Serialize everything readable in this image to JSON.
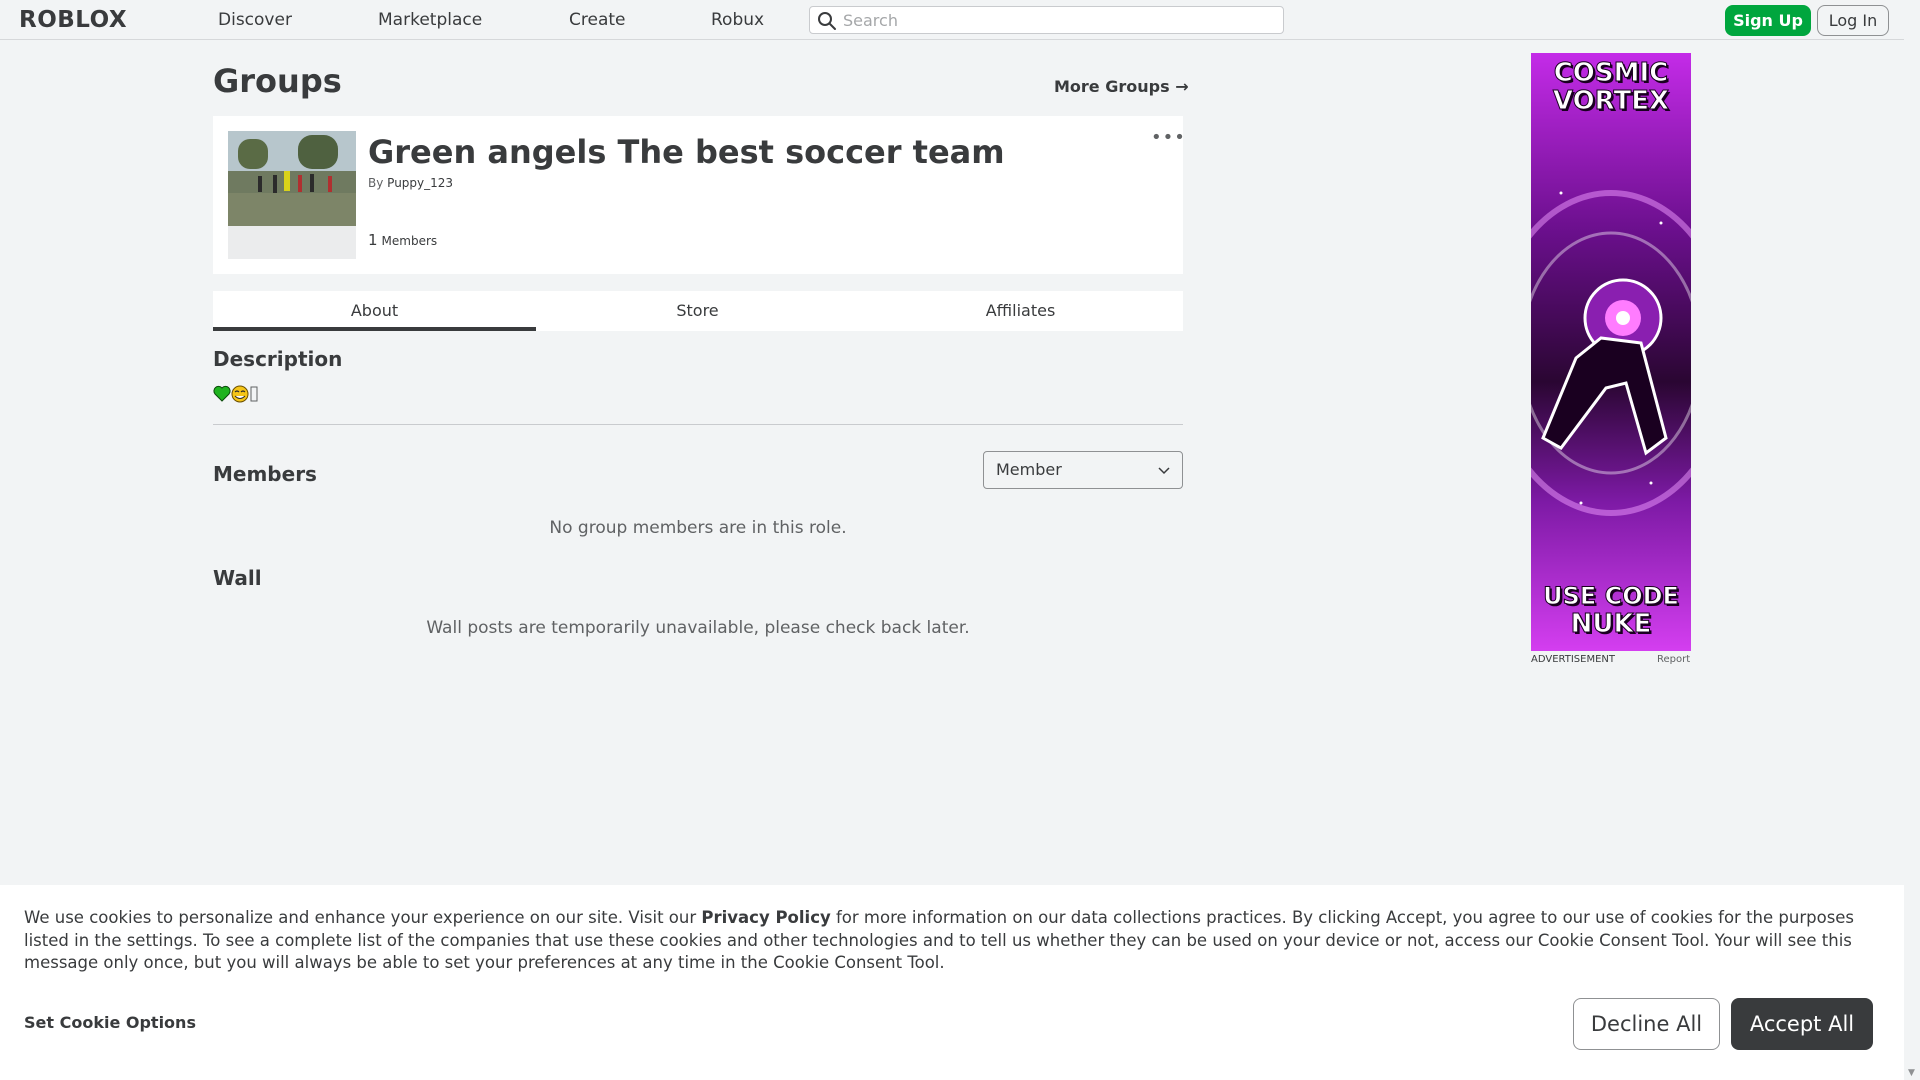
{
  "nav": {
    "logo_text": "ROBLOX",
    "links": [
      "Discover",
      "Marketplace",
      "Create",
      "Robux"
    ],
    "search_placeholder": "Search",
    "signup_label": "Sign Up",
    "login_label": "Log In"
  },
  "page": {
    "title": "Groups",
    "more_groups_label": "More Groups"
  },
  "group": {
    "name": "Green angels The best soccer team",
    "by_label": "By",
    "owner": "Puppy_123",
    "member_count": "1",
    "members_label": "Members",
    "more_menu": "•••"
  },
  "tabs": [
    "About",
    "Store",
    "Affiliates"
  ],
  "about": {
    "description_heading": "Description",
    "members_heading": "Members",
    "role_selected": "Member",
    "members_empty": "No group members are in this role.",
    "wall_heading": "Wall",
    "wall_empty": "Wall posts are temporarily unavailable, please check back later."
  },
  "ad": {
    "headline_top_1": "COSMIC",
    "headline_top_2": "VORTEX",
    "headline_bottom_1": "USE CODE",
    "headline_bottom_2": "NUKE",
    "label": "ADVERTISEMENT",
    "report": "Report"
  },
  "cookie": {
    "text_before": "We use cookies to personalize and enhance your experience on our site. Visit our ",
    "privacy_link": "Privacy Policy",
    "text_after": " for more information on our data collections practices. By clicking Accept, you agree to our use of cookies for the purposes listed in the settings. To see a complete list of the companies that use these cookies and other technologies and to tell us whether they can be used on your device or not, access our Cookie Consent Tool. Your will see this message only once, but you will always be able to set your preferences at any time in the Cookie Consent Tool.",
    "options_label": "Set Cookie Options",
    "decline_label": "Decline All",
    "accept_label": "Accept All"
  },
  "colors": {
    "signup": "#00a63e",
    "accept": "#393b3d",
    "background": "#f2f4f5"
  }
}
